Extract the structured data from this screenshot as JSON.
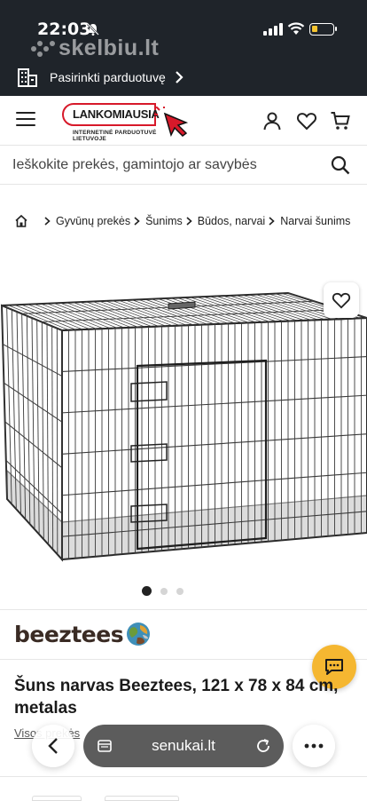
{
  "status_bar": {
    "time": "22:03",
    "watermark": "skelbiu.lt"
  },
  "store_selector": {
    "label": "Pasirinkti parduotuvę"
  },
  "header": {
    "logo_name": "LANKOMIAUSIA",
    "logo_tagline": "INTERNETINĖ PARDUOTUVĖ LIETUVOJE",
    "icons": [
      "menu-icon",
      "user-icon",
      "heart-icon",
      "cart-icon"
    ]
  },
  "search": {
    "placeholder": "Ieškokite prekės, gamintojo ar savybės"
  },
  "breadcrumb": {
    "items": [
      "Gyvūnų prekės",
      "Šunims",
      "Būdos, narvai",
      "Narvai šunims"
    ]
  },
  "gallery": {
    "slide_count": 3,
    "active_slide": 1
  },
  "brand": {
    "name": "beeztees"
  },
  "product": {
    "title": "Šuns narvas Beeztees, 121 x 78 x 84 cm, metalas",
    "subtitle_link": "Visos prekės"
  },
  "browser_bar": {
    "url": "senukai.lt"
  },
  "colors": {
    "accent_red": "#d7192a",
    "chat_yellow": "#f5b731",
    "topbar": "#1f242a"
  }
}
